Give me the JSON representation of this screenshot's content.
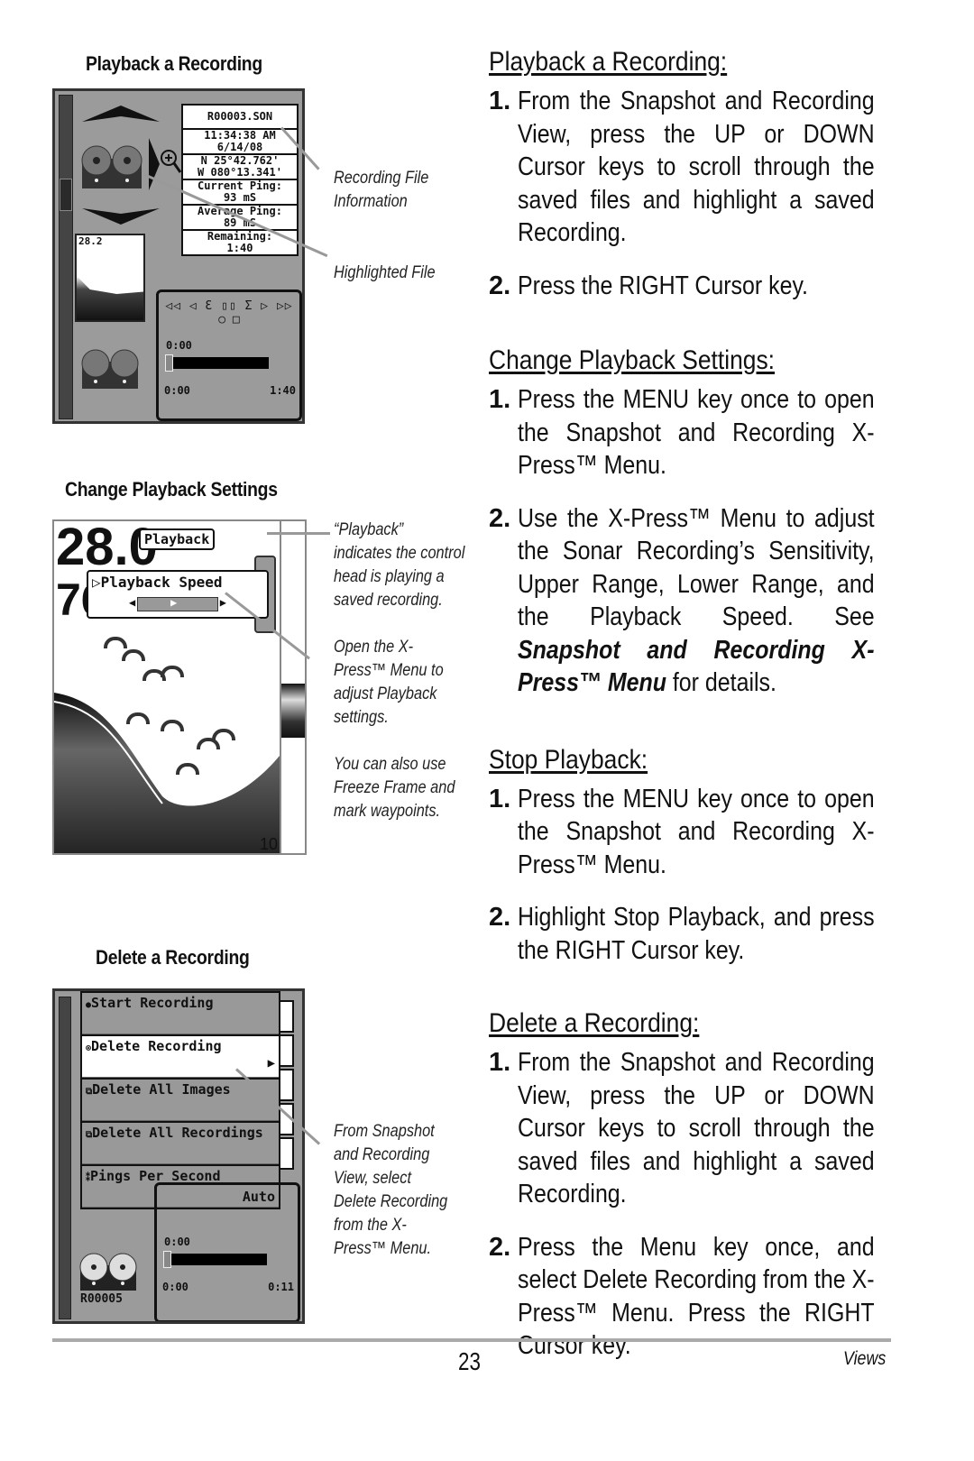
{
  "left": {
    "fig1": {
      "caption": "Playback a Recording",
      "file_info": {
        "filename": "R00003.SON",
        "time": "11:34:38 AM",
        "date": "6/14/08",
        "lat": "N 25°42.762'",
        "lon": "W 080°13.341'",
        "current_ping_label": "Current Ping:",
        "current_ping_value": "93 mS",
        "average_ping_label": "Average Ping:",
        "average_ping_value": "89 mS",
        "remaining_label": "Remaining:",
        "remaining_value": "1:40"
      },
      "thumb_depth": "28.2",
      "controls": "◁◁ ◁ Ɛ ▯▯ Ʃ ▷ ▷▷",
      "controls2": "○ □",
      "time_current": "0:00",
      "time_start": "0:00",
      "time_end": "1:40",
      "progress": 0.0,
      "callouts": [
        "Recording File Information",
        "Highlighted File"
      ]
    },
    "fig2": {
      "caption": "Change Playback Settings",
      "depth_top": "28.0",
      "depth_bottom": "76",
      "playback_badge": "Playback",
      "menu_item": "Playback Speed",
      "scale_bottom": "10",
      "callouts": [
        "“Playback” indicates the control head is playing a saved recording.",
        "Open the X-Press™ Menu to adjust Playback settings.",
        "You can also use Freeze Frame and mark waypoints."
      ]
    },
    "fig3": {
      "caption": "Delete a Recording",
      "menu": [
        {
          "icon": "record-dot-icon",
          "label": "Start Recording",
          "value": "",
          "selected": false
        },
        {
          "icon": "delete-icon",
          "label": "Delete Recording",
          "value": "",
          "selected": true
        },
        {
          "icon": "delete-all-icon",
          "label": "Delete All Images",
          "value": "",
          "selected": false
        },
        {
          "icon": "delete-all-icon",
          "label": "Delete All Recordings",
          "value": "",
          "selected": false
        },
        {
          "icon": "settings-icon",
          "label": "Pings Per Second",
          "value": "Auto",
          "selected": false
        }
      ],
      "file_label": "R00005",
      "time_current": "0:00",
      "time_start": "0:00",
      "time_end": "0:11",
      "progress": 0.0,
      "callout": "From Snapshot and Recording View, select Delete Recording from the X-Press™ Menu."
    }
  },
  "right": {
    "sections": [
      {
        "heading": "Playback a Recording:",
        "steps": [
          {
            "num": "1.",
            "text": "From the Snapshot and Recording View, press the UP or DOWN Cursor keys to scroll through the saved files and highlight a saved Recording."
          },
          {
            "num": "2.",
            "text": "Press the RIGHT Cursor key."
          }
        ]
      },
      {
        "heading": "Change Playback Settings:",
        "steps": [
          {
            "num": "1.",
            "text": "Press the MENU key once to open the Snapshot and Recording X-Press™ Menu."
          },
          {
            "num": "2.",
            "text": "Use the X-Press™ Menu to adjust the Sonar Recording’s Sensitivity, Upper Range, Lower Range, and the Playback Speed. See ",
            "italic": "Snapshot and Recording X-Press™ Menu",
            "after": " for details."
          }
        ]
      },
      {
        "heading": "Stop Playback:",
        "steps": [
          {
            "num": "1.",
            "text": "Press the MENU key once to open the Snapshot and Recording X-Press™ Menu."
          },
          {
            "num": "2.",
            "text": "Highlight Stop Playback, and press the RIGHT Cursor key."
          }
        ]
      },
      {
        "heading": "Delete a Recording:",
        "steps": [
          {
            "num": "1.",
            "text": "From the Snapshot and Recording View, press the UP or DOWN Cursor keys to scroll through the saved files and highlight a saved Recording."
          },
          {
            "num": "2.",
            "text": "Press the Menu key once, and select Delete Recording from the X-Press™ Menu. Press the RIGHT Cursor key."
          }
        ]
      }
    ]
  },
  "footer": {
    "page_number": "23",
    "section": "Views"
  }
}
